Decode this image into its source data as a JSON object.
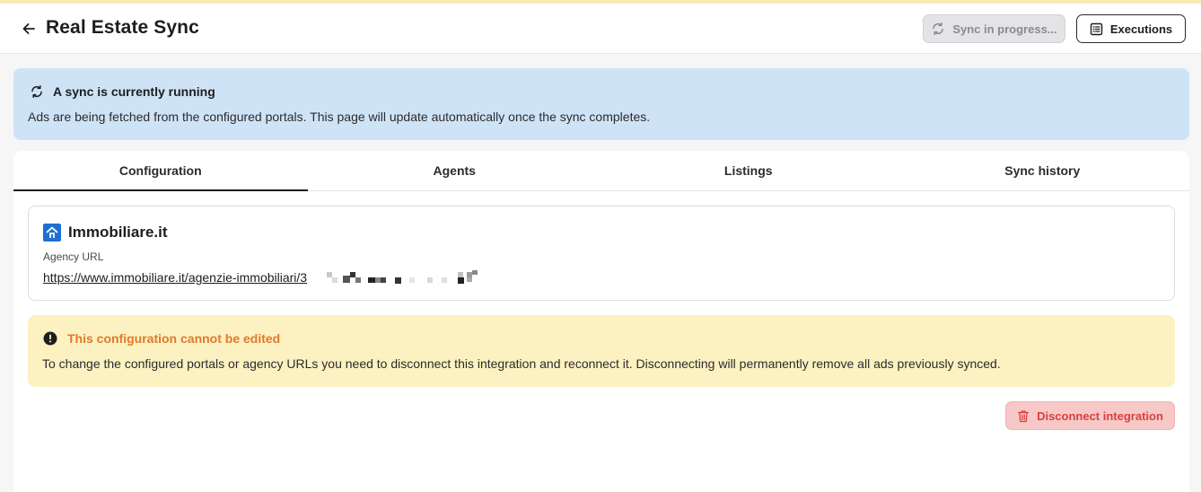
{
  "header": {
    "title": "Real Estate Sync",
    "sync_button_label": "Sync in progress...",
    "executions_button_label": "Executions"
  },
  "info_banner": {
    "title": "A sync is currently running",
    "text": "Ads are being fetched from the configured portals. This page will update automatically once the sync completes."
  },
  "tabs": [
    {
      "label": "Configuration",
      "active": true
    },
    {
      "label": "Agents",
      "active": false
    },
    {
      "label": "Listings",
      "active": false
    },
    {
      "label": "Sync history",
      "active": false
    }
  ],
  "portal": {
    "name": "Immobiliare.it",
    "url_label": "Agency URL",
    "url": "https://www.immobiliare.it/agenzie-immobiliari/3"
  },
  "warning": {
    "title": "This configuration cannot be edited",
    "text": "To change the configured portals or agency URLs you need to disconnect this integration and reconnect it. Disconnecting will permanently remove all ads previously synced."
  },
  "actions": {
    "disconnect_label": "Disconnect integration"
  },
  "colors": {
    "info_bg": "#cfe3f6",
    "warning_bg": "#fcf1c0",
    "warning_title": "#e07a2c",
    "danger": "#d9413d",
    "portal_brand": "#1f6fd1"
  }
}
